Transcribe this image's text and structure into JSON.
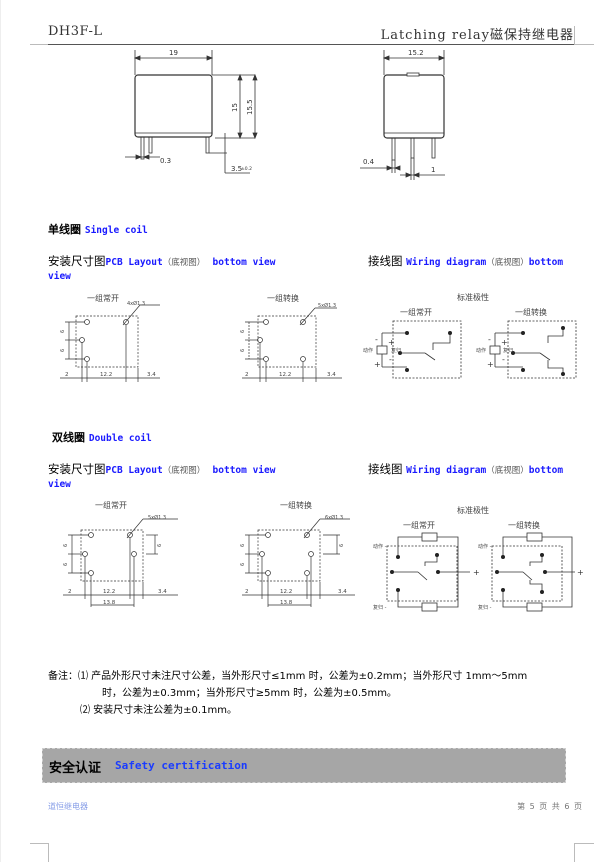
{
  "header": {
    "model": "DH3F-L",
    "title_en": "Latching relay",
    "title_cn": "磁保持继电器"
  },
  "outline_drawing": {
    "front_view": {
      "width": "19",
      "height_body": "15",
      "height_total": "15.5",
      "pin_thickness": "0.3",
      "pin_length": "3.5",
      "pin_length_tol": "±0.2"
    },
    "side_view": {
      "width": "15.2",
      "pin_width": "0.4",
      "pin_offset": "1"
    }
  },
  "single_coil": {
    "title_cn": "单线圈",
    "title_en": "Single coil",
    "pcb": {
      "label_cn": "安装尺寸图",
      "label_en": "PCB Layout",
      "paren": "（底视图）",
      "view_en": "bottom view",
      "view_wrap": "view",
      "diagrams": [
        {
          "title": "一组常开",
          "holes": "4xØ1.3",
          "pitch_v1": "6",
          "pitch_v2": "6",
          "dim_left": "2",
          "dim_mid": "12.2",
          "dim_right": "3.4"
        },
        {
          "title": "一组转换",
          "holes": "5xØ1.3",
          "pitch_v1": "6",
          "pitch_v2": "6",
          "dim_left": "2",
          "dim_mid": "12.2",
          "dim_right": "3.4"
        }
      ]
    },
    "wiring": {
      "label_cn": "接线图",
      "label_en": "Wiring diagram",
      "paren": "（底视图）",
      "view_en": "bottom",
      "polarity_title": "标准极性",
      "diagrams": [
        {
          "title": "一组常开",
          "act": "动作",
          "reset": "复归",
          "minus": "-",
          "plus": "+"
        },
        {
          "title": "一组转换",
          "act": "动作",
          "reset": "复归",
          "minus": "-",
          "plus": "+"
        }
      ]
    }
  },
  "double_coil": {
    "title_cn": "双线圈",
    "title_en": "Double coil",
    "pcb": {
      "label_cn": "安装尺寸图",
      "label_en": "PCB Layout",
      "paren": "（底视图）",
      "view_en": "bottom view",
      "view_wrap": "view",
      "diagrams": [
        {
          "title": "一组常开",
          "holes": "5xØ1.3",
          "pitch_v1": "6",
          "pitch_v2": "6",
          "pitch_r": "6",
          "dim_left": "2",
          "dim_mid": "12.2",
          "dim_right": "3.4",
          "dim_bottom": "13.8"
        },
        {
          "title": "一组转换",
          "holes": "6xØ1.3",
          "pitch_v1": "6",
          "pitch_v2": "6",
          "pitch_r": "6",
          "dim_left": "2",
          "dim_mid": "12.2",
          "dim_right": "3.4",
          "dim_bottom": "13.8"
        }
      ]
    },
    "wiring": {
      "label_cn": "接线图",
      "label_en": "Wiring diagram",
      "paren": "（底视图）",
      "view_en": "bottom",
      "polarity_title": "标准极性",
      "diagrams": [
        {
          "title": "一组常开",
          "act": "动作 -",
          "reset": "复归 -",
          "plus": "+"
        },
        {
          "title": "一组转换",
          "act": "动作 -",
          "reset": "复归 -",
          "plus": "+"
        }
      ]
    }
  },
  "notes": {
    "label": "备注：",
    "line1": "⑴ 产品外形尺寸未注尺寸公差，当外形尺寸≤1mm 时，公差为±0.2mm；当外形尺寸 1mm～5mm",
    "line2": "时，公差为±0.3mm；当外形尺寸≥5mm 时，公差为±0.5mm。",
    "line3": "⑵ 安装尺寸未注公差为±0.1mm。"
  },
  "safety": {
    "title_cn": "安全认证",
    "title_en": "Safety certification"
  },
  "footer": {
    "company": "道恒继电器",
    "page_text": "第 5 页 共 6 页"
  }
}
